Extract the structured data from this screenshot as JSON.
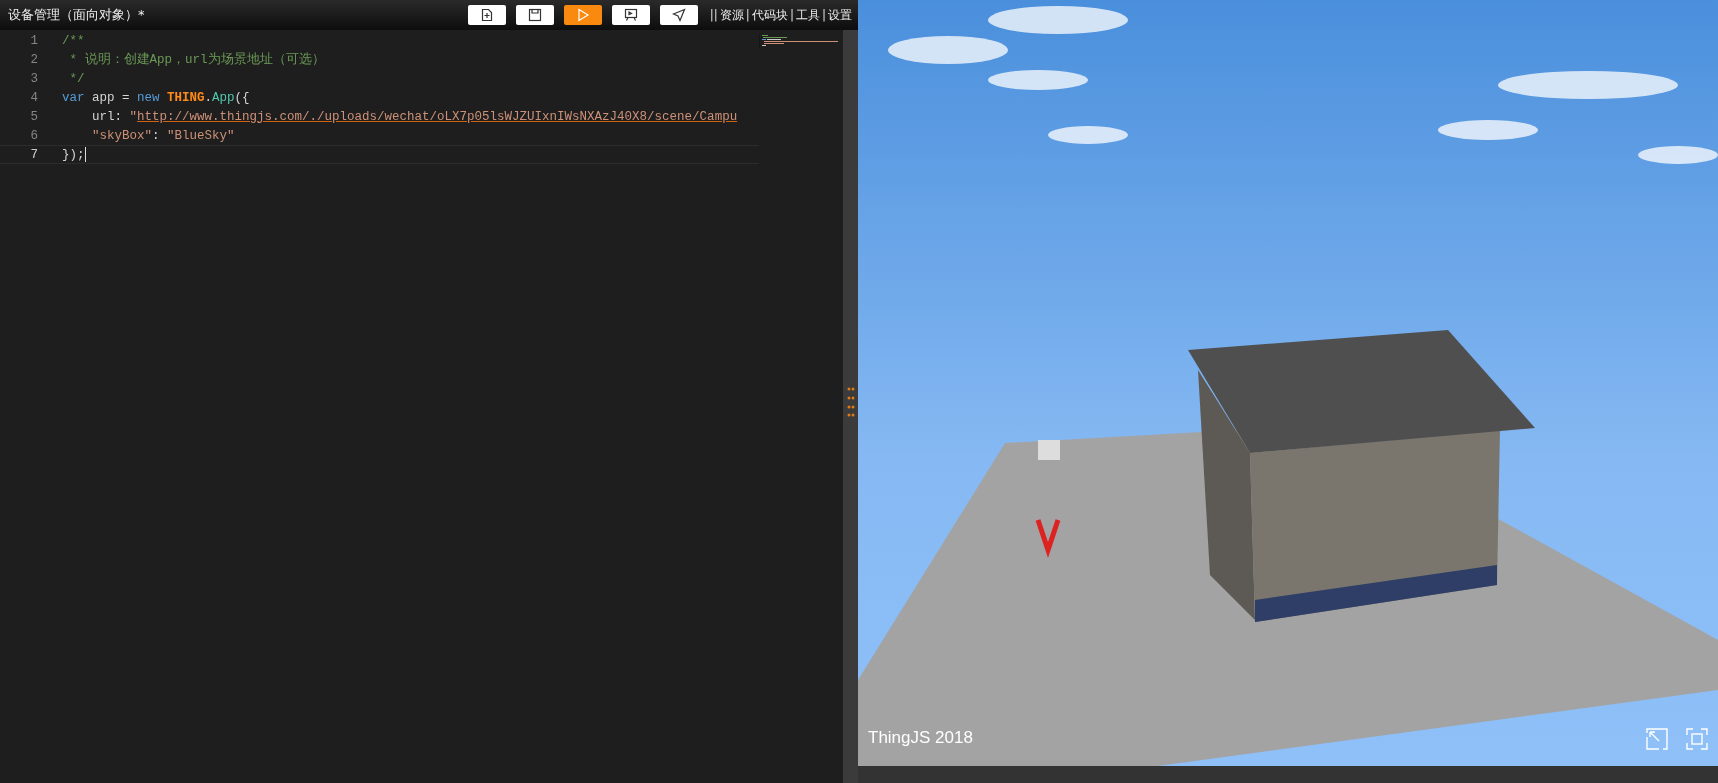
{
  "window": {
    "title": "设备管理（面向对象）*"
  },
  "toolbar": {
    "buttons": [
      {
        "kind": "new",
        "selected": false
      },
      {
        "kind": "save",
        "selected": false
      },
      {
        "kind": "run",
        "selected": true
      },
      {
        "kind": "present",
        "selected": false
      },
      {
        "kind": "send",
        "selected": false
      }
    ],
    "links": [
      {
        "prefix": "||",
        "label": "资源"
      },
      {
        "prefix": "|",
        "label": "代码块"
      },
      {
        "prefix": "|",
        "label": "工具"
      },
      {
        "prefix": "|",
        "label": "设置"
      }
    ]
  },
  "editor": {
    "lines": [
      {
        "number": "1",
        "active": false,
        "tokens": [
          {
            "kind": "comment",
            "text": "/**"
          }
        ]
      },
      {
        "number": "2",
        "active": false,
        "tokens": [
          {
            "kind": "comment",
            "text": " * 说明：创建App，url为场景地址（可选）"
          }
        ]
      },
      {
        "number": "3",
        "active": false,
        "tokens": [
          {
            "kind": "comment",
            "text": " */"
          }
        ]
      },
      {
        "number": "4",
        "active": false,
        "tokens": [
          {
            "kind": "keyword",
            "text": "var"
          },
          {
            "kind": "plain",
            "text": " app = "
          },
          {
            "kind": "keyword",
            "text": "new "
          },
          {
            "kind": "namespace",
            "text": "THING"
          },
          {
            "kind": "plain",
            "text": "."
          },
          {
            "kind": "class",
            "text": "App"
          },
          {
            "kind": "plain",
            "text": "({"
          }
        ]
      },
      {
        "number": "5",
        "active": false,
        "tokens": [
          {
            "kind": "plain",
            "text": "    url: "
          },
          {
            "kind": "string",
            "text": "\""
          },
          {
            "kind": "link",
            "text": "http://www.thingjs.com/./uploads/wechat/oLX7p05lsWJZUIxnIWsNXAzJ40X8/scene/Campu"
          }
        ]
      },
      {
        "number": "6",
        "active": false,
        "tokens": [
          {
            "kind": "string",
            "text": "    \"skyBox\""
          },
          {
            "kind": "plain",
            "text": ": "
          },
          {
            "kind": "string",
            "text": "\"BlueSky\""
          }
        ]
      },
      {
        "number": "7",
        "active": true,
        "tokens": [
          {
            "kind": "plain",
            "text": "});"
          }
        ]
      }
    ]
  },
  "viewport": {
    "caption": "ThingJS 2018"
  }
}
